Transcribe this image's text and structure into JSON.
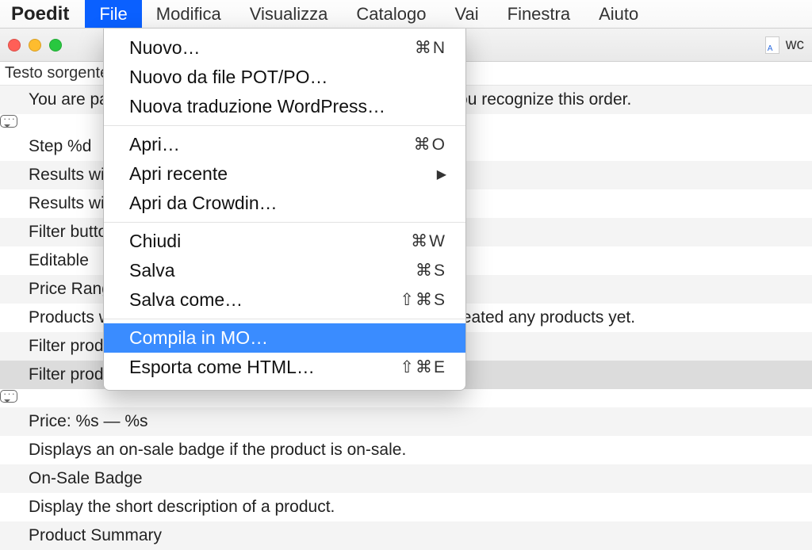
{
  "app_name": "Poedit",
  "menubar": [
    "File",
    "Modifica",
    "Visualizza",
    "Catalogo",
    "Vai",
    "Finestra",
    "Aiuto"
  ],
  "active_menu_index": 0,
  "toolbar": {
    "filename": "wc"
  },
  "column_header": "Testo sorgente",
  "rows": [
    {
      "text": "You are paying for these items. Continue payment only if you recognize this order.",
      "icon": null,
      "variant": "alt"
    },
    {
      "text": "Step %d",
      "icon": "speech",
      "variant": ""
    },
    {
      "text": "Results will ...",
      "icon": null,
      "variant": "alt"
    },
    {
      "text": "Results will ...",
      "icon": null,
      "variant": ""
    },
    {
      "text": "Filter button",
      "icon": null,
      "variant": "alt"
    },
    {
      "text": "Editable",
      "icon": null,
      "variant": ""
    },
    {
      "text": "Price Range",
      "icon": null,
      "variant": "alt"
    },
    {
      "text": "Products with prices are not shown because you haven't created any products yet.",
      "icon": null,
      "variant": ""
    },
    {
      "text": "Filter products",
      "icon": null,
      "variant": "alt"
    },
    {
      "text": "Filter products",
      "icon": null,
      "variant": "selected"
    },
    {
      "text": "Price: %s — %s",
      "icon": "speech",
      "variant": "alt"
    },
    {
      "text": "Displays an on-sale badge if the product is on-sale.",
      "icon": null,
      "variant": ""
    },
    {
      "text": "On-Sale Badge",
      "icon": null,
      "variant": "alt"
    },
    {
      "text": "Display the short description of a product.",
      "icon": null,
      "variant": ""
    },
    {
      "text": "Product Summary",
      "icon": null,
      "variant": "alt"
    }
  ],
  "dropdown": {
    "groups": [
      [
        {
          "label": "Nuovo…",
          "shortcut": "⌘N"
        },
        {
          "label": "Nuovo da file POT/PO…",
          "shortcut": ""
        },
        {
          "label": "Nuova traduzione WordPress…",
          "shortcut": ""
        }
      ],
      [
        {
          "label": "Apri…",
          "shortcut": "⌘O"
        },
        {
          "label": "Apri recente",
          "shortcut": "",
          "submenu": true
        },
        {
          "label": "Apri da Crowdin…",
          "shortcut": ""
        }
      ],
      [
        {
          "label": "Chiudi",
          "shortcut": "⌘W"
        },
        {
          "label": "Salva",
          "shortcut": "⌘S"
        },
        {
          "label": "Salva come…",
          "shortcut": "⇧⌘S"
        }
      ],
      [
        {
          "label": "Compila in MO…",
          "shortcut": "",
          "highlight": true
        },
        {
          "label": "Esporta come HTML…",
          "shortcut": "⇧⌘E"
        }
      ]
    ]
  }
}
